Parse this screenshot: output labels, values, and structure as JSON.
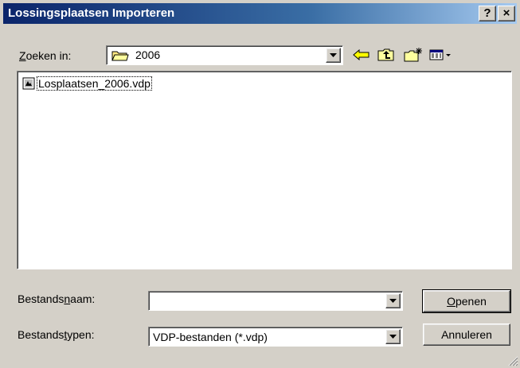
{
  "window": {
    "title": "Lossingsplaatsen Importeren",
    "help_label": "?",
    "close_label": "×"
  },
  "lookin": {
    "label_accel": "Z",
    "label_rest": "oeken in:",
    "value": "2006"
  },
  "toolbar": {
    "icons": [
      "back-arrow-icon",
      "up-folder-icon",
      "new-folder-icon",
      "view-menu-icon"
    ],
    "accent_color": "#ffff00"
  },
  "filelist": {
    "items": [
      {
        "name": "Losplaatsen_2006.vdp",
        "icon": "vdp-file-icon"
      }
    ]
  },
  "filename": {
    "label_pre": "Bestands",
    "label_accel": "n",
    "label_post": "aam:",
    "value": ""
  },
  "filetype": {
    "label_pre": "Bestands",
    "label_accel": "t",
    "label_post": "ypen:",
    "value": "VDP-bestanden (*.vdp)"
  },
  "buttons": {
    "open_accel": "O",
    "open_rest": "penen",
    "cancel": "Annuleren"
  },
  "colors": {
    "titlebar_start": "#0a246a",
    "titlebar_end": "#a6caf0",
    "face": "#d4d0c8"
  }
}
